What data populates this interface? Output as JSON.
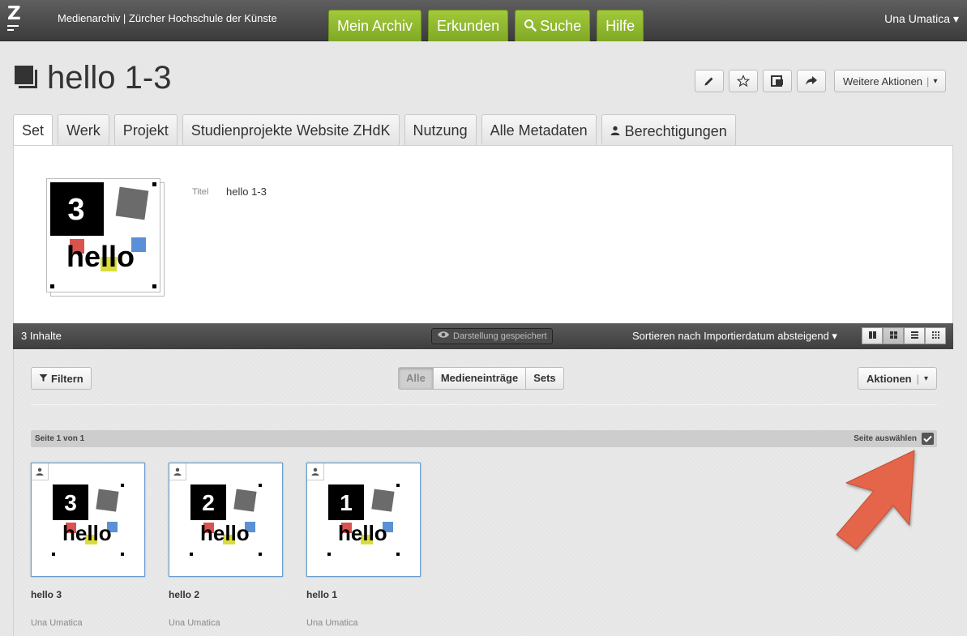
{
  "header": {
    "logo_letter": "Z",
    "brand": "Medienarchiv | Zürcher Hochschule der Künste",
    "nav": [
      "Mein Archiv",
      "Erkunden",
      "Suche",
      "Hilfe"
    ],
    "user": "Una Umatica ▾",
    "accent": "#8db62e"
  },
  "page": {
    "title": "hello 1-3",
    "more_actions": "Weitere Aktionen",
    "more_actions_caret": "▾"
  },
  "tabs": [
    "Set",
    "Werk",
    "Projekt",
    "Studienprojekte Website ZHdK",
    "Nutzung",
    "Alle Metadaten",
    "Berechtigungen"
  ],
  "set_meta": {
    "label": "Titel",
    "value": "hello 1-3",
    "thumb": {
      "digit": "3",
      "word": "hello"
    }
  },
  "listing": {
    "count": "3 Inhalte",
    "saved": "Darstellung gespeichert",
    "sort": "Sortieren nach Importierdatum absteigend ▾",
    "filter": "Filtern",
    "segments": [
      "Alle",
      "Medieneinträge",
      "Sets"
    ],
    "actions": "Aktionen",
    "actions_caret": "▾",
    "page_label": "Seite 1 von 1",
    "select_page": "Seite auswählen",
    "items": [
      {
        "title": "hello 3",
        "owner": "Una Umatica",
        "digit": "3",
        "word": "hello"
      },
      {
        "title": "hello 2",
        "owner": "Una Umatica",
        "digit": "2",
        "word": "hello"
      },
      {
        "title": "hello 1",
        "owner": "Una Umatica",
        "digit": "1",
        "word": "hello"
      }
    ]
  },
  "colors": {
    "arrow": "#e4654a",
    "tile_border": "#6a9ccd"
  }
}
